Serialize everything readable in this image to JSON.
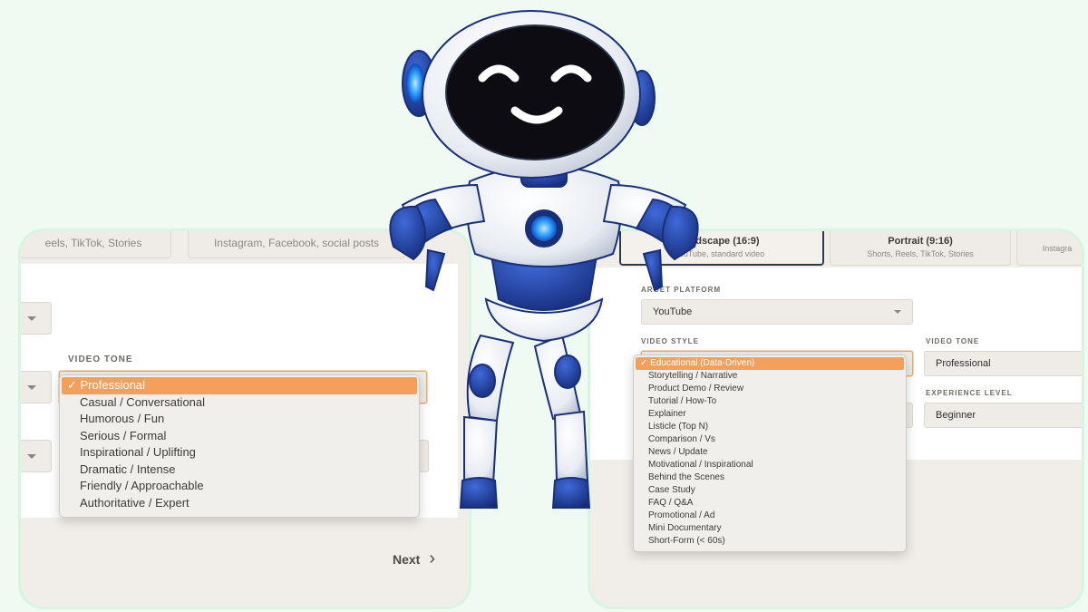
{
  "left": {
    "card_partial_1": "eels, TikTok, Stories",
    "card_partial_2": "Instagram, Facebook, social posts",
    "video_tone_label": "VIDEO TONE",
    "tone_options": [
      "✓ Professional",
      "Casual / Conversational",
      "Humorous / Fun",
      "Serious / Formal",
      "Inspirational / Uplifting",
      "Dramatic / Intense",
      "Friendly / Approachable",
      "Authoritative / Expert"
    ],
    "next_label": "Next",
    "next_arrow": "›"
  },
  "right": {
    "cards": [
      {
        "title": "andscape (16:9)",
        "sub": "ouTube, standard video"
      },
      {
        "title": "Portrait (9:16)",
        "sub": "Shorts, Reels, TikTok, Stories"
      },
      {
        "title": "",
        "sub": "Instagra"
      }
    ],
    "target_platform_label": "ARGET PLATFORM",
    "target_platform_value": "YouTube",
    "video_style_label": "VIDEO STYLE",
    "video_tone_label": "VIDEO TONE",
    "video_tone_value": "Professional",
    "experience_label": "EXPERIENCE LEVEL",
    "experience_value": "Beginner",
    "style_options": [
      "✓ Educational (Data-Driven)",
      "Storytelling / Narrative",
      "Product Demo / Review",
      "Tutorial / How-To",
      "Explainer",
      "Listicle (Top N)",
      "Comparison / Vs",
      "News / Update",
      "Motivational / Inspirational",
      "Behind the Scenes",
      "Case Study",
      "FAQ / Q&A",
      "Promotional / Ad",
      "Mini Documentary",
      "Short-Form (< 60s)"
    ]
  },
  "colors": {
    "background": "#effbf2",
    "accent": "#f4a05a",
    "robot_blue": "#1f3a93"
  }
}
